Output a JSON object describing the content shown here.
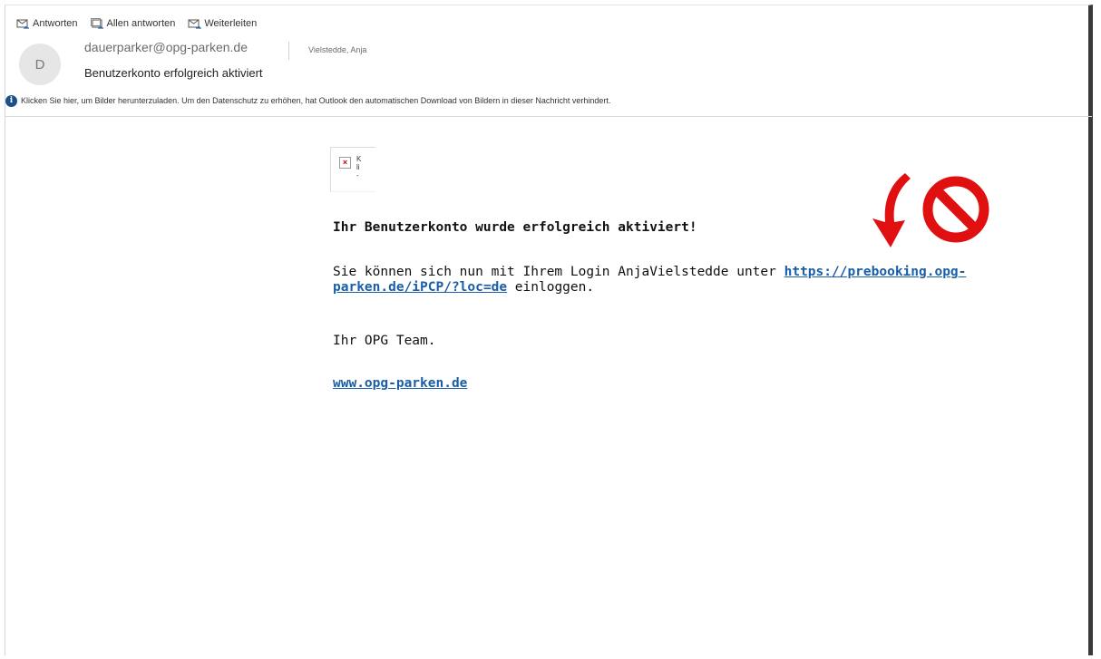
{
  "toolbar": {
    "reply_label": "Antworten",
    "reply_all_label": "Allen antworten",
    "forward_label": "Weiterleiten"
  },
  "header": {
    "avatar_initial": "D",
    "sender": "dauerparker@opg-parken.de",
    "recipient": "Vielstedde, Anja",
    "subject": "Benutzerkonto erfolgreich aktiviert"
  },
  "infobar": {
    "text": "Klicken Sie hier, um Bilder herunterzuladen. Um den Datenschutz zu erhöhen, hat Outlook den automatischen Download von Bildern in dieser Nachricht verhindert."
  },
  "message": {
    "broken_image_alt": "K\nli\n-",
    "title": "Ihr Benutzerkonto wurde erfolgreich aktiviert!",
    "para_prefix": "Sie können sich nun mit Ihrem Login AnjaVielstedde unter ",
    "login_link": "https://prebooking.opg-parken.de/iPCP/?loc=de",
    "para_suffix": " einloggen.",
    "signature": "Ihr OPG Team.",
    "website_link": "www.opg-parken.de"
  },
  "colors": {
    "warning_red": "#e01010",
    "link_blue": "#1a5ea8",
    "info_blue": "#1a4f8a"
  },
  "icons": [
    "reply-icon",
    "reply-all-icon",
    "forward-icon",
    "info-icon",
    "broken-image-icon",
    "red-arrow-icon",
    "prohibited-icon"
  ]
}
